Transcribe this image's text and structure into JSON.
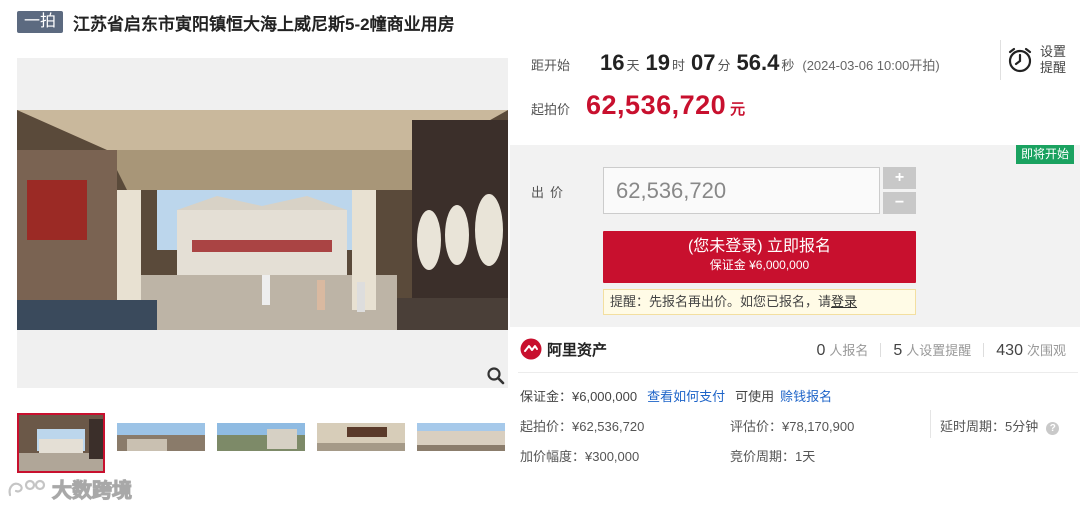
{
  "header": {
    "tag": "一拍",
    "title": "江苏省启东市寅阳镇恒大海上威尼斯5-2幢商业用房"
  },
  "countdown": {
    "label": "距开始",
    "days": "16",
    "days_unit": "天",
    "hours": "19",
    "hours_unit": "时",
    "minutes": "07",
    "minutes_unit": "分",
    "seconds": "56.4",
    "seconds_unit": "秒",
    "start_note": "(2024-03-06 10:00开拍)"
  },
  "reminder": {
    "label": "设置提醒",
    "icon": "alarm-clock-icon"
  },
  "start_price": {
    "label": "起拍价",
    "value": "62,536,720",
    "unit": "元"
  },
  "bid": {
    "status_badge": "即将开始",
    "label": "出价",
    "input_placeholder": "62,536,720",
    "plus": "+",
    "minus": "−",
    "register_main": "(您未登录) 立即报名",
    "register_sub": "保证金 ¥6,000,000",
    "hint_prefix": "提醒：先报名再出价。如您已报名，请",
    "hint_link": "登录"
  },
  "brand": {
    "name": "阿里资产"
  },
  "stats": {
    "signups": "0",
    "signups_label": "人报名",
    "reminders": "5",
    "reminders_label": "人设置提醒",
    "views": "430",
    "views_label": "次围观"
  },
  "deposit": {
    "label": "保证金：¥6,000,000",
    "how_to_pay": "查看如何支付",
    "available": "可使用",
    "credit_signup": "赊钱报名"
  },
  "details": {
    "start_price": "起拍价：¥62,536,720",
    "appraisal": "评估价：¥78,170,900",
    "delay_label": "延时周期：",
    "delay_value": "5分钟",
    "increment": "加价幅度：¥300,000",
    "cycle": "竞价周期：1天"
  },
  "watermark": {
    "text": "大数跨境"
  },
  "colors": {
    "accent_red": "#c8102e",
    "badge_green": "#1aa260",
    "link_blue": "#1e64c8",
    "tag_gray": "#5c6a80"
  }
}
